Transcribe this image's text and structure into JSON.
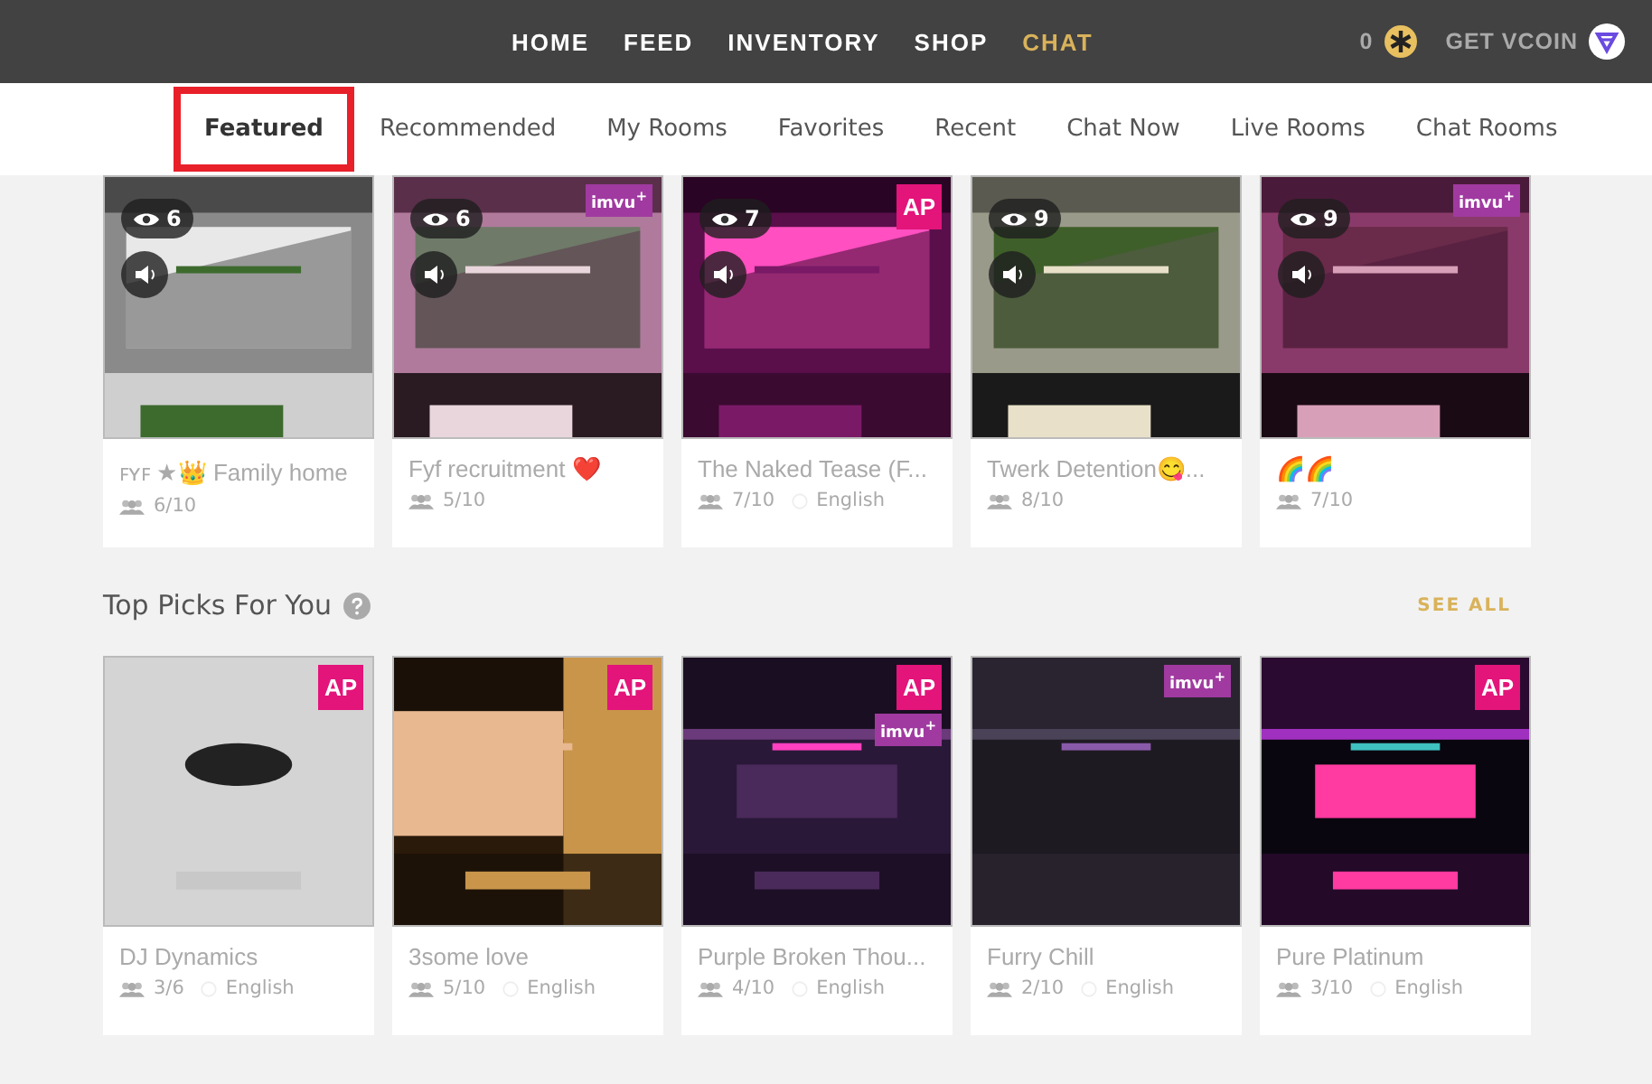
{
  "nav": {
    "items": [
      {
        "label": "HOME",
        "selected": false
      },
      {
        "label": "FEED",
        "selected": false
      },
      {
        "label": "INVENTORY",
        "selected": false
      },
      {
        "label": "SHOP",
        "selected": false
      },
      {
        "label": "CHAT",
        "selected": true
      }
    ],
    "balance": "0",
    "vcoin_link": "GET VCOIN"
  },
  "tabs": [
    {
      "label": "Featured",
      "selected": true,
      "highlighted": true
    },
    {
      "label": "Recommended",
      "selected": false,
      "highlighted": false
    },
    {
      "label": "My Rooms",
      "selected": false,
      "highlighted": false
    },
    {
      "label": "Favorites",
      "selected": false,
      "highlighted": false
    },
    {
      "label": "Recent",
      "selected": false,
      "highlighted": false
    },
    {
      "label": "Chat Now",
      "selected": false,
      "highlighted": false
    },
    {
      "label": "Live Rooms",
      "selected": false,
      "highlighted": false
    },
    {
      "label": "Chat Rooms",
      "selected": false,
      "highlighted": false
    }
  ],
  "live_rooms": [
    {
      "name": "ꜰʏꜰ ★👑 Family home",
      "occupancy": "6/10",
      "viewers": "6"
    },
    {
      "name": "Fyf recruitment ❤️",
      "occupancy": "5/10",
      "viewers": "6",
      "badges": [
        {
          "kind": "imvu",
          "label": "imvu$^{+}$"
        }
      ]
    },
    {
      "name": "The Naked Tease (F...",
      "occupancy": "7/10",
      "language": "English",
      "viewers": "7",
      "badges": [
        {
          "kind": "ap",
          "label": "AP"
        }
      ]
    },
    {
      "name": "Twerk Detention😋...",
      "occupancy": "8/10",
      "viewers": "9"
    },
    {
      "name": "🌈🌈",
      "occupancy": "7/10",
      "viewers": "9",
      "badges": [
        {
          "kind": "imvu",
          "label": "imvu$^{+}$"
        }
      ]
    }
  ],
  "top_picks": {
    "title": "Top Picks For You",
    "see_all": "SEE ALL",
    "rooms": [
      {
        "name": "DJ Dynamics",
        "occupancy": "3/6",
        "language": "English",
        "badges": [
          {
            "kind": "ap",
            "label": "AP"
          }
        ]
      },
      {
        "name": "3some love",
        "occupancy": "5/10",
        "language": "English",
        "badges": [
          {
            "kind": "ap",
            "label": "AP"
          }
        ]
      },
      {
        "name": "Purple Broken Thou...",
        "occupancy": "4/10",
        "language": "English",
        "badges": [
          {
            "kind": "ap",
            "label": "AP"
          },
          {
            "kind": "imvu",
            "label": "imvu$^{+}$"
          }
        ]
      },
      {
        "name": "Furry Chill",
        "occupancy": "2/10",
        "language": "English",
        "badges": [
          {
            "kind": "imvu",
            "label": "imvu$^{+}$"
          }
        ]
      },
      {
        "name": "Pure Platinum",
        "occupancy": "3/10",
        "language": "English",
        "badges": [
          {
            "kind": "ap",
            "label": "AP"
          }
        ]
      }
    ]
  }
}
